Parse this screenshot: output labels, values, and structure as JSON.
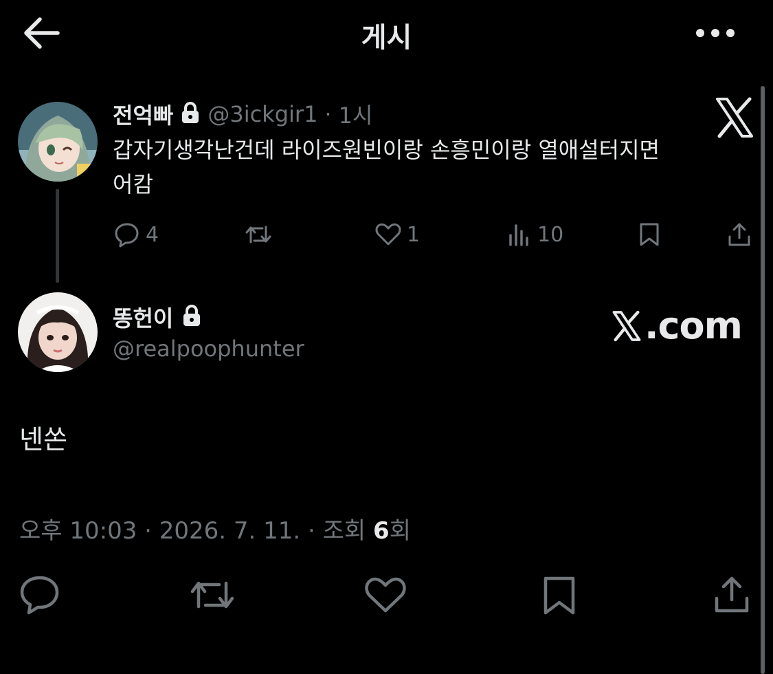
{
  "header": {
    "title": "게시"
  },
  "original_post": {
    "display_name": "전억빠",
    "handle": "@3ickgir1",
    "separator": "·",
    "time": "1시",
    "text_line1": "갑자기생각난건데 라이즈원빈이랑 손흥민이랑 열애설터지면",
    "text_line2": "어캄",
    "stats": {
      "replies": "4",
      "likes": "1",
      "views": "10"
    }
  },
  "reply_post": {
    "display_name": "똥헌이",
    "handle": "@realpoophunter",
    "text": "넨쏜",
    "meta_time": "오후 10:03 · 2026. 7. 11. · 조회 ",
    "meta_views": "6",
    "meta_suffix": "회"
  },
  "watermark": {
    "x_logo": "X",
    "x_com": ".com"
  },
  "colors": {
    "background": "#000000",
    "text": "#e7e9ea",
    "muted": "#71767b",
    "line": "#333639"
  }
}
